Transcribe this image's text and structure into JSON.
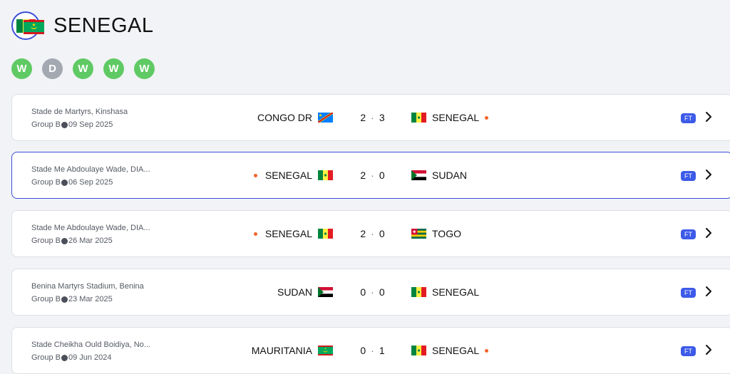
{
  "team": {
    "name": "SENEGAL",
    "flag": "senegal"
  },
  "opponent_flag": "mauritania",
  "form": [
    {
      "result": "W",
      "color": "#5fca64"
    },
    {
      "result": "D",
      "color": "#a4a8b1"
    },
    {
      "result": "W",
      "color": "#5fca64"
    },
    {
      "result": "W",
      "color": "#5fca64"
    },
    {
      "result": "W",
      "color": "#5fca64"
    }
  ],
  "matches": [
    {
      "venue": "Stade de Martyrs, Kinshasa",
      "group": "Group B",
      "date": "09 Sep 2025",
      "home": "CONGO DR",
      "home_flag": "congo-dr",
      "home_score": "2",
      "away_score": "3",
      "away": "SENEGAL",
      "away_flag": "senegal",
      "status": "FT"
    },
    {
      "venue": "Stade Me Abdoulaye Wade, DIA...",
      "group": "Group B",
      "date": "06 Sep 2025",
      "home": "SENEGAL",
      "home_flag": "senegal",
      "home_score": "2",
      "away_score": "0",
      "away": "SUDAN",
      "away_flag": "sudan",
      "status": "FT"
    },
    {
      "venue": "Stade Me Abdoulaye Wade, DIA...",
      "group": "Group B",
      "date": "26 Mar 2025",
      "home": "SENEGAL",
      "home_flag": "senegal",
      "home_score": "2",
      "away_score": "0",
      "away": "TOGO",
      "away_flag": "togo",
      "status": "FT"
    },
    {
      "venue": "Benina Martyrs Stadium, Benina",
      "group": "Group B",
      "date": "23 Mar 2025",
      "home": "SUDAN",
      "home_flag": "sudan",
      "home_score": "0",
      "away_score": "0",
      "away": "SENEGAL",
      "away_flag": "senegal",
      "status": "FT"
    },
    {
      "venue": "Stade Cheikha Ould Boidiya, No...",
      "group": "Group B",
      "date": "09 Jun 2024",
      "home": "MAURITANIA",
      "home_flag": "mauritania",
      "home_score": "0",
      "away_score": "1",
      "away": "SENEGAL",
      "away_flag": "senegal",
      "status": "FT"
    }
  ]
}
